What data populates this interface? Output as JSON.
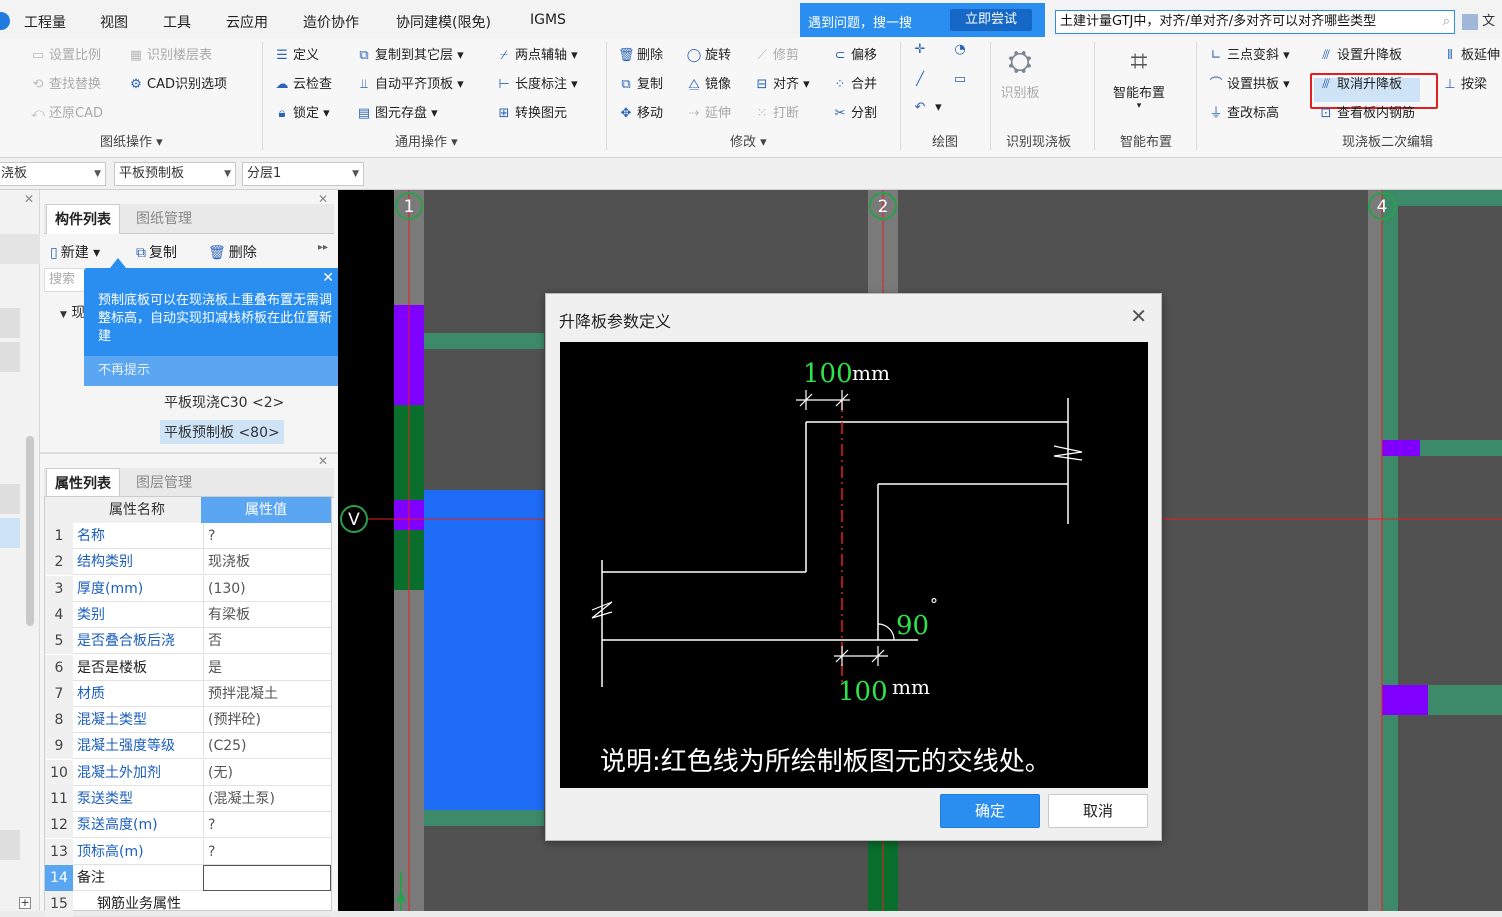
{
  "menu": [
    "工程量",
    "视图",
    "工具",
    "云应用",
    "造价协作",
    "协同建模(限免)",
    "IGMS"
  ],
  "search": {
    "tip": "遇到问题，搜一搜",
    "try_label": "立即尝试",
    "query": "土建计量GTJ中，对齐/单对齐/多对齐可以对齐哪些类型",
    "user_label": "文"
  },
  "ribbon": {
    "drawing_ops": {
      "items": [
        "设置比例",
        "识别楼层表",
        "查找替换",
        "CAD识别选项",
        "还原CAD"
      ],
      "group": "图纸操作"
    },
    "common_ops": {
      "items": [
        "定义",
        "复制到其它层",
        "两点辅轴",
        "云检查",
        "自动平齐顶板",
        "长度标注",
        "锁定",
        "图元存盘",
        "转换图元"
      ],
      "group": "通用操作"
    },
    "modify": {
      "items": [
        "删除",
        "旋转",
        "修剪",
        "偏移",
        "复制",
        "镜像",
        "对齐",
        "合并",
        "移动",
        "延伸",
        "打断",
        "分割"
      ],
      "group": "修改"
    },
    "draw": {
      "group": "绘图"
    },
    "recognize": {
      "label": "识别板",
      "group": "识别现浇板"
    },
    "smart": {
      "label": "智能布置",
      "group": "智能布置"
    },
    "edit2": {
      "items": [
        "三点变斜",
        "设置升降板",
        "板延伸",
        "设置拱板",
        "取消升降板",
        "按梁",
        "查改标高",
        "查看板内钢筋"
      ],
      "group": "现浇板二次编辑"
    }
  },
  "filters": [
    "浇板",
    "平板预制板",
    "分层1"
  ],
  "component_panel": {
    "tabs": [
      "构件列表",
      "图纸管理"
    ],
    "toolbar": [
      "新建",
      "复制",
      "删除"
    ],
    "search_placeholder": "搜索",
    "tree_root": "现",
    "items": [
      "平板现浇C30 <2>",
      "平板预制板 <80>"
    ],
    "tip": {
      "message": "预制底板可以在现浇板上重叠布置无需调整标高，自动实现扣减栈桥板在此位置新建",
      "dismiss": "不再提示"
    }
  },
  "property_panel": {
    "tabs": [
      "属性列表",
      "图层管理"
    ],
    "headers": [
      "属性名称",
      "属性值"
    ],
    "rows": [
      {
        "n": "1",
        "k": "名称",
        "v": "?"
      },
      {
        "n": "2",
        "k": "结构类别",
        "v": "现浇板"
      },
      {
        "n": "3",
        "k": "厚度(mm)",
        "v": "(130)"
      },
      {
        "n": "4",
        "k": "类别",
        "v": "有梁板"
      },
      {
        "n": "5",
        "k": "是否叠合板后浇",
        "v": "否"
      },
      {
        "n": "6",
        "k": "是否是楼板",
        "v": "是"
      },
      {
        "n": "7",
        "k": "材质",
        "v": "预拌混凝土"
      },
      {
        "n": "8",
        "k": "混凝土类型",
        "v": "(预拌砼)"
      },
      {
        "n": "9",
        "k": "混凝土强度等级",
        "v": "(C25)"
      },
      {
        "n": "10",
        "k": "混凝土外加剂",
        "v": "(无)"
      },
      {
        "n": "11",
        "k": "泵送类型",
        "v": "(混凝土泵)"
      },
      {
        "n": "12",
        "k": "泵送高度(m)",
        "v": "?"
      },
      {
        "n": "13",
        "k": "顶标高(m)",
        "v": "?"
      },
      {
        "n": "14",
        "k": "备注",
        "v": ""
      },
      {
        "n": "15",
        "k": "钢筋业务属性",
        "v": ""
      }
    ]
  },
  "canvas": {
    "axes": [
      "1",
      "2",
      "4",
      "V"
    ]
  },
  "dialog": {
    "title": "升降板参数定义",
    "dim_top": "100",
    "dim_bottom": "100",
    "unit": "mm",
    "angle": "90",
    "note": "说明:红色线为所绘制板图元的交线处。",
    "ok": "确定",
    "cancel": "取消"
  }
}
